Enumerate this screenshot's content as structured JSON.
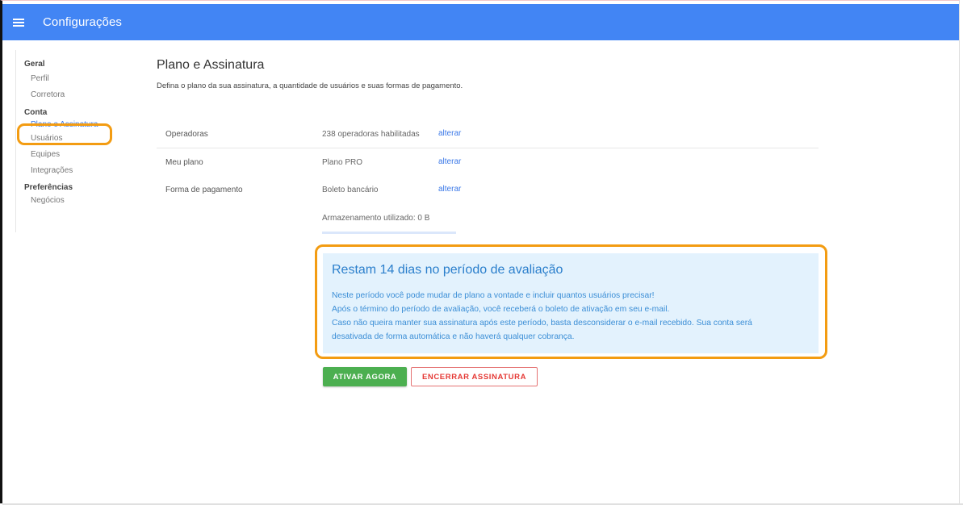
{
  "app": {
    "title": "Configurações"
  },
  "sidebar": {
    "groups": [
      {
        "label": "Geral",
        "items": [
          "Perfil",
          "Corretora"
        ]
      },
      {
        "label": "Conta",
        "items": [
          "Plano e Assinatura",
          "Usuários",
          "Equipes",
          "Integrações"
        ]
      },
      {
        "label": "Preferências",
        "items": [
          "Negócios"
        ]
      }
    ],
    "active_item": "Plano e Assinatura"
  },
  "page": {
    "title": "Plano e Assinatura",
    "description": "Defina o plano da sua assinatura, a quantidade de usuários e suas formas de pagamento."
  },
  "settings": {
    "rows": [
      {
        "label": "Operadoras",
        "value": "238 operadoras habilitadas",
        "action": "alterar"
      },
      {
        "label": "Meu plano",
        "value": "Plano PRO",
        "action": "alterar"
      },
      {
        "label": "Forma de pagamento",
        "value": "Boleto bancário",
        "action": "alterar"
      }
    ],
    "storage_label": "Armazenamento utilizado: 0 B",
    "storage_used_percent": 0
  },
  "trial": {
    "title": "Restam 14 dias no período de avaliação",
    "lines": [
      "Neste período você pode mudar de plano a vontade e incluir quantos usuários precisar!",
      "Após o término do período de avaliação, você receberá o boleto de ativação em seu e-mail.",
      "Caso não queira manter sua assinatura após este período, basta desconsiderar o e-mail recebido. Sua conta será",
      "desativada de forma automática e não haverá qualquer cobrança."
    ]
  },
  "actions": {
    "activate_label": "ATIVAR AGORA",
    "cancel_label": "ENCERRAR ASSINATURA"
  },
  "colors": {
    "topbar": "#4285f4",
    "accent": "#3b78e7",
    "highlight": "#f39c12",
    "activate": "#4caf50",
    "cancel": "#e53935",
    "trial_bg": "#e3f2fd"
  }
}
